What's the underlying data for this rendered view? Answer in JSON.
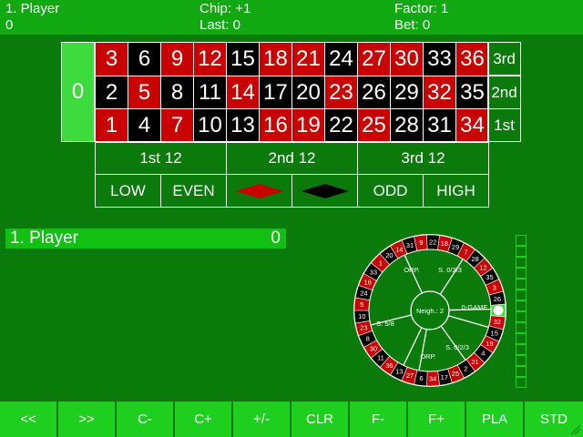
{
  "header": {
    "player_label": "1. Player",
    "player_value": "0",
    "chip": "Chip: +1",
    "last": "Last: 0",
    "factor": "Factor: 1",
    "bet": "Bet: 0"
  },
  "board": {
    "zero": "0",
    "rows": [
      [
        3,
        6,
        9,
        12,
        15,
        18,
        21,
        24,
        27,
        30,
        33,
        36
      ],
      [
        2,
        5,
        8,
        11,
        14,
        17,
        20,
        23,
        26,
        29,
        32,
        35
      ],
      [
        1,
        4,
        7,
        10,
        13,
        16,
        19,
        22,
        25,
        28,
        31,
        34
      ]
    ],
    "red_numbers": [
      1,
      3,
      5,
      7,
      9,
      12,
      14,
      16,
      18,
      19,
      21,
      23,
      25,
      27,
      30,
      32,
      34,
      36
    ],
    "columns": [
      "3rd",
      "2nd",
      "1st"
    ],
    "dozens": [
      "1st 12",
      "2nd 12",
      "3rd 12"
    ],
    "outside": {
      "low": "LOW",
      "even": "EVEN",
      "odd": "ODD",
      "high": "HIGH"
    }
  },
  "player_list": [
    {
      "name": "1. Player",
      "score": "0"
    }
  ],
  "wheel": {
    "numbers": [
      0,
      32,
      15,
      19,
      4,
      21,
      2,
      25,
      17,
      34,
      6,
      27,
      13,
      36,
      11,
      30,
      8,
      23,
      10,
      5,
      24,
      16,
      33,
      1,
      20,
      14,
      31,
      9,
      22,
      18,
      29,
      7,
      28,
      12,
      35,
      3,
      26
    ],
    "sections": {
      "neighbours": "Neigh.: 2",
      "orphelins_top": "ORP.",
      "orphelins_bottom": "ORP.",
      "series_023_top": "S. 0/2/3",
      "series_023_bottom": "S. 0/2/3",
      "zero_game": "0-GAME",
      "series_58": "S. 5/8"
    }
  },
  "buttons": [
    "<<",
    ">>",
    "C-",
    "C+",
    "+/-",
    "CLR",
    "F-",
    "F+",
    "PLA",
    "STD"
  ],
  "colors": {
    "felt": "#0a7a0a",
    "header": "#12a812",
    "button": "#1fcf1f",
    "red": "#c80000",
    "black": "#000000",
    "zero": "#3ddb3d"
  }
}
